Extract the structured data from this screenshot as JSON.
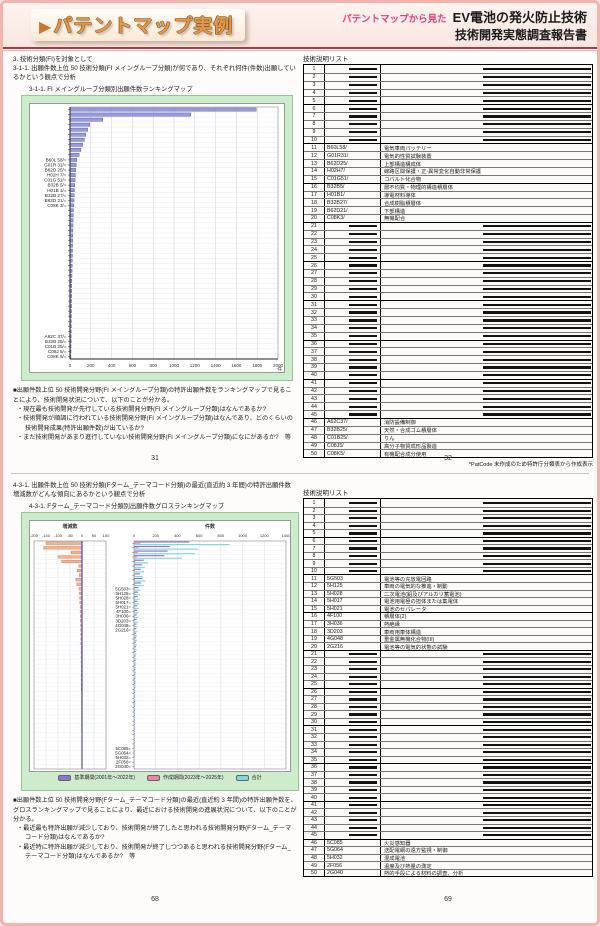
{
  "header": {
    "banner_arrow": "▶",
    "banner_text": "パテントマップ実例",
    "tagline": "パテントマップから見た",
    "title": "EV電池の発火防止技術",
    "subtitle": "技術開発実態調査報告書"
  },
  "top_left": {
    "section": "3. 技術分類(FI)を対象として",
    "para": "3-1-1. 出願件数上位 50 技術分類(FI メイングループ分類)が何であり、それぞれ何件(件数)出願しているかという観点で分析",
    "chart_caption": "3-1-1. FI メイングループ分類別出願件数ランキングマップ",
    "bullets_intro": "■出願件数上位 50 技術開発分野(FI メイングループ分類)の特許出願件数をランキングマップで見ることにより、技術開発状況について、以下のことが分かる。",
    "bullets": [
      "・現在最も技術開発が先行している技術開発分野(FI メイングループ分類)はなんであるか?",
      "・技術開発が順調に行われている技術開発分野(FI メイングループ分類)はなんであり、どのくらいの技術開発成果(特許出願件数)が出ているか?",
      "・まだ技術開発があまり進行していない技術開発分野(FI メイングループ分類)になにがあるか?　等"
    ],
    "page_number": "31"
  },
  "top_right": {
    "list_title": "技術説明リスト",
    "note": "*PatCode 未作成のため特許庁分類表から作成表示",
    "page_number": "32",
    "rows": [
      [
        "1"
      ],
      [
        "2"
      ],
      [
        "3"
      ],
      [
        "4"
      ],
      [
        "5"
      ],
      [
        "6"
      ],
      [
        "7"
      ],
      [
        "8"
      ],
      [
        "9"
      ],
      [
        "10"
      ],
      [
        "11",
        "B60L58/",
        "電気車両バッテリー"
      ],
      [
        "12",
        "G01R31/",
        "電気的性質試験装置"
      ],
      [
        "13",
        "B62D25/",
        "上部構造構成体"
      ],
      [
        "14",
        "H02H7/",
        "線路区間保護・正-異常変化自動非常保護"
      ],
      [
        "15",
        "C01G51/",
        "コバルト化合物"
      ],
      [
        "16",
        "B32B5/",
        "層不均質・物理的構造積層体"
      ],
      [
        "17",
        "H01B1/",
        "導電材料導体"
      ],
      [
        "18",
        "B32B27/",
        "合成樹脂積層体"
      ],
      [
        "19",
        "B62D21/",
        "下部構造"
      ],
      [
        "20",
        "C08K3/",
        "無機配合"
      ],
      [
        "21"
      ],
      [
        "22"
      ],
      [
        "23"
      ],
      [
        "24"
      ],
      [
        "25"
      ],
      [
        "26"
      ],
      [
        "27"
      ],
      [
        "28"
      ],
      [
        "29"
      ],
      [
        "30"
      ],
      [
        "31"
      ],
      [
        "32"
      ],
      [
        "33"
      ],
      [
        "34"
      ],
      [
        "35"
      ],
      [
        "36"
      ],
      [
        "37"
      ],
      [
        "38"
      ],
      [
        "39"
      ],
      [
        "40"
      ],
      [
        "41"
      ],
      [
        "42"
      ],
      [
        "43"
      ],
      [
        "44"
      ],
      [
        "45"
      ],
      [
        "46",
        "A62C37/",
        "消防設備制御"
      ],
      [
        "47",
        "B32B25/",
        "天然・合成ゴム積層体"
      ],
      [
        "48",
        "C01B25/",
        "りん"
      ],
      [
        "49",
        "C08J5/",
        "高分子物質成形品製造"
      ],
      [
        "50",
        "C08K5/",
        "有機配合成分使用"
      ]
    ]
  },
  "bottom_left": {
    "para": "4-3-1. 出願件数上位 50 技術分類(Fターム_テーマコード分類)の最近(直近約 3 年間)の特許出願件数増減数がどんな傾向にあるかという観点で分析",
    "chart_caption": "4-3-1. Fターム_テーマコード分類別出願件数グロスランキングマップ",
    "bullets_intro": "■出願件数上位 50 技術開発分野(Fターム_テーマコード分類)の最近(直近約 3 年間)の特許出願件数を、グロスランキングマップで見ることにより、最近における技術開発の進展状況について、以下のことが分かる。",
    "bullets": [
      "・最近最も特許出願が減少しており、技術開発が終了したと思われる技術開発分野(Fターム_テーマコード分類)はなんであるか?",
      "・最近特に特許出願が減少しており、技術開発が終了しつつあると思われる技術開発分野(Fターム_テーマコード分類)はなんであるか?　等"
    ],
    "page_number": "68"
  },
  "bottom_right": {
    "list_title": "技術説明リスト",
    "page_number": "69",
    "rows": [
      [
        "1"
      ],
      [
        "2"
      ],
      [
        "3"
      ],
      [
        "4"
      ],
      [
        "5"
      ],
      [
        "6"
      ],
      [
        "7"
      ],
      [
        "8"
      ],
      [
        "9"
      ],
      [
        "10"
      ],
      [
        "11",
        "5G503",
        "電池等の充放電回路"
      ],
      [
        "12",
        "5H125",
        "車両の電気的な推進・制動"
      ],
      [
        "13",
        "5H028",
        "二次電池(鉛及びアルカリ蓄電池)"
      ],
      [
        "14",
        "5H017",
        "電池用電極の担体または集電体"
      ],
      [
        "15",
        "5H021",
        "電池のセパレータ"
      ],
      [
        "16",
        "4F100",
        "積層体(2)"
      ],
      [
        "17",
        "3H036",
        "熱絶縁"
      ],
      [
        "18",
        "3D203",
        "車両用車体構造"
      ],
      [
        "19",
        "4G048",
        "重金属無機化合物(III)"
      ],
      [
        "20",
        "2G216",
        "電池等の電気的状態の試験"
      ],
      [
        "21"
      ],
      [
        "22"
      ],
      [
        "23"
      ],
      [
        "24"
      ],
      [
        "25"
      ],
      [
        "26"
      ],
      [
        "27"
      ],
      [
        "28"
      ],
      [
        "29"
      ],
      [
        "30"
      ],
      [
        "31"
      ],
      [
        "32"
      ],
      [
        "33"
      ],
      [
        "34"
      ],
      [
        "35"
      ],
      [
        "36"
      ],
      [
        "37"
      ],
      [
        "38"
      ],
      [
        "39"
      ],
      [
        "40"
      ],
      [
        "41"
      ],
      [
        "42"
      ],
      [
        "43"
      ],
      [
        "44"
      ],
      [
        "45"
      ],
      [
        "46",
        "5C085",
        "火災感知器"
      ],
      [
        "47",
        "5G064",
        "送配電網の遠方監視・制御"
      ],
      [
        "48",
        "5H032",
        "混成電池"
      ],
      [
        "49",
        "2F056",
        "温度及び熱量の測定"
      ],
      [
        "50",
        "2G040",
        "熱的手段による材料の調査、分析"
      ]
    ]
  },
  "chart_data": [
    {
      "type": "bar",
      "orientation": "horizontal",
      "title": "FI メイングループ分類別出願件数ランキングマップ",
      "xlabel": "件",
      "xlim": [
        0,
        2000
      ],
      "xticks": [
        0,
        200,
        400,
        600,
        800,
        1000,
        1200,
        1400,
        1600,
        1800,
        2000
      ],
      "bar_color": "#9a9ade",
      "categories": [
        "",
        "",
        "",
        "",
        "",
        "",
        "",
        "",
        "",
        "",
        "B60L 58/=",
        "G01R 31/=",
        "B62D 25/=",
        "H02H 7/=",
        "C01G 51/=",
        "B32B 5/=",
        "H01B 1/=",
        "B32B 27/=",
        "B62D 21/=",
        "C08K 3/=",
        "",
        "",
        "",
        "",
        "",
        "",
        "",
        "",
        "",
        "",
        "",
        "",
        "",
        "",
        "",
        "",
        "",
        "",
        "",
        "",
        "",
        "",
        "",
        "",
        "",
        "A62C 37/=",
        "B32B 25/=",
        "C01B 25/=",
        "C08J 5/=",
        "C08K 5/="
      ],
      "values": [
        1790,
        1160,
        315,
        190,
        170,
        152,
        138,
        122,
        104,
        88,
        66,
        60,
        56,
        52,
        49,
        46,
        43,
        41,
        39,
        37,
        34,
        32,
        30,
        29,
        28,
        27,
        26,
        25,
        24,
        23,
        22,
        21,
        20,
        19,
        18,
        17,
        16,
        16,
        15,
        15,
        14,
        14,
        13,
        13,
        12,
        11,
        11,
        10,
        10,
        9
      ]
    },
    {
      "type": "bar-dual",
      "title": "Fターム_テーマコード分類別出願件数グロスランキングマップ",
      "categories": [
        "",
        "",
        "",
        "",
        "",
        "",
        "",
        "",
        "",
        "",
        "5G503=",
        "5H125=",
        "5H028=",
        "5H017=",
        "5H021=",
        "4F100=",
        "3H036=",
        "3D203=",
        "4G048=",
        "2G216=",
        "",
        "",
        "",
        "",
        "",
        "",
        "",
        "",
        "",
        "",
        "",
        "",
        "",
        "",
        "",
        "",
        "",
        "",
        "",
        "",
        "",
        "",
        "",
        "",
        "",
        "5C085=",
        "5G064=",
        "5H032=",
        "2F056=",
        "2G040="
      ],
      "panels": [
        {
          "title": "増減数",
          "xlim": [
            -200,
            100
          ],
          "xticks": [
            -200,
            -150,
            -100,
            -50,
            0,
            50,
            100
          ],
          "bar_color": "#f2b48c",
          "values": [
            -150,
            -160,
            -45,
            -100,
            -85,
            -14,
            -20,
            -12,
            -26,
            -22,
            -13,
            -11,
            -10,
            -9,
            -8,
            -8,
            -7,
            -7,
            -6,
            -6,
            -5,
            -5,
            -5,
            -4,
            -4,
            -4,
            -4,
            -3,
            -3,
            -3,
            -3,
            -3,
            -3,
            -2,
            -2,
            -2,
            -2,
            -2,
            -2,
            -2,
            -2,
            -2,
            -1,
            -1,
            -1,
            -1,
            -1,
            -1,
            -1,
            -1
          ]
        },
        {
          "title": "件数",
          "xlim": [
            0,
            1400
          ],
          "xticks": [
            0,
            200,
            400,
            600,
            800,
            1000,
            1200,
            1400
          ],
          "series": [
            {
              "name": "基準期間(2001年～2022年)",
              "color": "#8878cc",
              "values": [
                510,
                330,
                310,
                280,
                90,
                72,
                62,
                56,
                76,
                66,
                42,
                38,
                35,
                32,
                30,
                28,
                26,
                25,
                24,
                22,
                20,
                19,
                18,
                17,
                16,
                15,
                15,
                14,
                13,
                13,
                12,
                12,
                11,
                11,
                10,
                10,
                9,
                9,
                9,
                8,
                8,
                8,
                7,
                7,
                7,
                6,
                6,
                6,
                5,
                5
              ]
            },
            {
              "name": "作成期間(2023年～2025年)",
              "color": "#e888a8",
              "values": [
                60,
                42,
                36,
                30,
                14,
                10,
                9,
                8,
                10,
                9,
                6,
                5,
                5,
                4,
                4,
                4,
                4,
                3,
                3,
                3,
                3,
                3,
                2,
                2,
                2,
                2,
                2,
                2,
                2,
                2,
                2,
                1,
                1,
                1,
                1,
                1,
                1,
                1,
                1,
                1,
                1,
                1,
                1,
                1,
                1,
                1,
                1,
                1,
                1,
                1
              ]
            },
            {
              "name": "合計",
              "color": "#86d6de",
              "values": [
                880,
                590,
                560,
                440,
                130,
                100,
                92,
                82,
                105,
                92,
                60,
                55,
                50,
                46,
                42,
                40,
                38,
                36,
                34,
                32,
                28,
                26,
                25,
                24,
                22,
                21,
                20,
                19,
                18,
                17,
                16,
                15,
                15,
                14,
                13,
                13,
                12,
                12,
                11,
                11,
                10,
                10,
                9,
                9,
                9,
                8,
                8,
                7,
                7,
                7
              ]
            }
          ]
        }
      ]
    }
  ]
}
